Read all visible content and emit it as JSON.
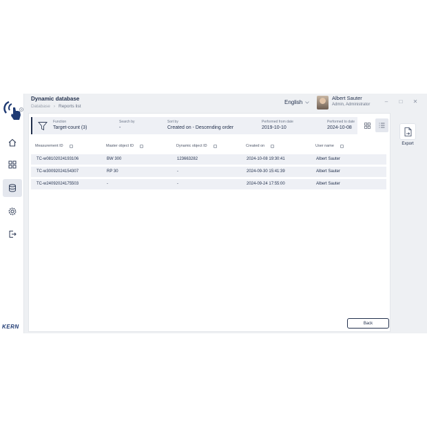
{
  "header": {
    "title": "Dynamic database",
    "breadcrumb": [
      "Database",
      "Reports list"
    ],
    "language": "English",
    "user_name": "Albert Sauter",
    "user_role": "Admin, Administrator"
  },
  "window_controls": {
    "minimize": "–",
    "maximize": "□",
    "close": "✕"
  },
  "brand": {
    "logo_text": "KERN",
    "accent": "#1f2d4a"
  },
  "filter": {
    "function_label": "Function",
    "function_value": "Target-count (3)",
    "search_label": "Search by",
    "search_value": "-",
    "sort_label": "Sort by",
    "sort_value": "Created on - Descending order",
    "from_label": "Performed from date",
    "from_value": "2019-10-10",
    "to_label": "Performed to date",
    "to_value": "2024-10-08"
  },
  "table": {
    "columns": [
      "Measurement ID",
      "Master object ID",
      "Dynamic object ID",
      "Created on",
      "User name"
    ],
    "rows": [
      [
        "TC-w08102024193106",
        "BW 300",
        "123663282",
        "2024-10-08 19:30:41",
        "Albert Sauter"
      ],
      [
        "TC-w30092024154307",
        "RP 30",
        "-",
        "2024-09-30 15:41:39",
        "Albert Sauter"
      ],
      [
        "TC-w24092024175503",
        "-",
        "-",
        "2024-09-24 17:55:00",
        "Albert Sauter"
      ]
    ]
  },
  "actions": {
    "export_label": "Export",
    "back_label": "Back"
  }
}
